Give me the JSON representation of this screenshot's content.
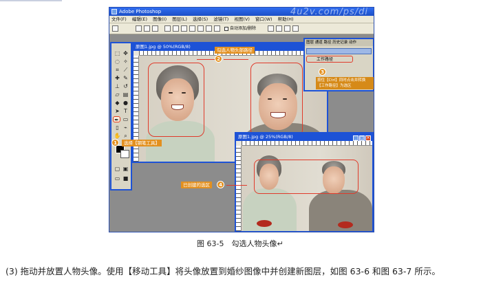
{
  "app": {
    "title": "Adobe Photoshop",
    "watermark": "4u2v.com/ps/di",
    "menu": [
      "文件(F)",
      "编辑(E)",
      "图像(I)",
      "图层(L)",
      "选择(S)",
      "滤镜(T)",
      "视图(V)",
      "窗口(W)",
      "帮助(H)"
    ],
    "options_checkbox": "自动添加/删除"
  },
  "doc1": {
    "title": "原图1.jpg @ 50%(RGB/8)"
  },
  "doc2": {
    "title": "原图1.jpg @ 25%(RGB/8)"
  },
  "panel": {
    "tabs": "图层 通道 路径 历史记录 动作",
    "item_label": "工作路径",
    "note": "按住【Ctrl】同时点击并转换【工作路径】为选区"
  },
  "callouts": {
    "c1_num": "1",
    "c1_label": "选择【钢笔工具】",
    "c2_num": "2",
    "c2_label": "勾选人物头部路径",
    "c3_num": "3",
    "c4_num": "4",
    "c4_label": "已创建的选区"
  },
  "caption": "图 63-5　勾选人物头像↵",
  "body_text": "(3) 拖动并放置人物头像。使用【移动工具】将头像放置到婚纱图像中并创建新图层，如图  63-6 和图  63-7 所示。",
  "colors": {
    "title_blue": "#1d52d6",
    "selection_red": "#e03a2a",
    "callout_orange": "#e3901f"
  }
}
